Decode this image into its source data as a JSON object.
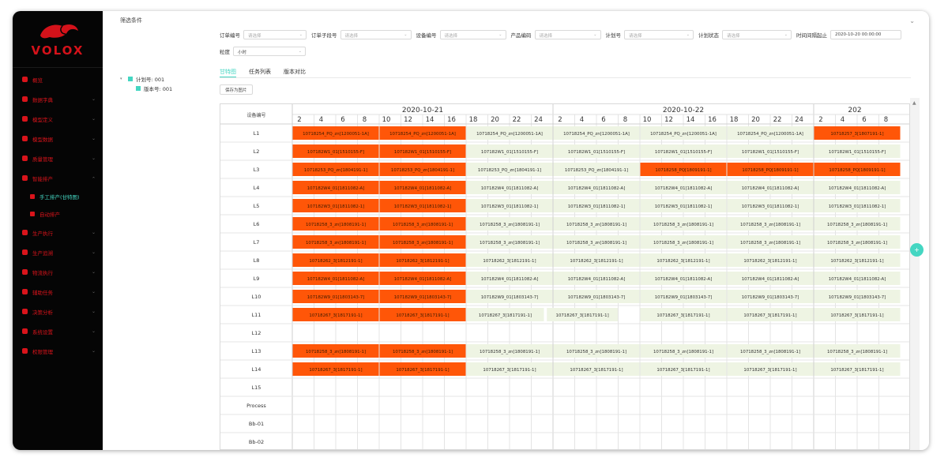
{
  "brand": {
    "name": "VOLOX",
    "color": "#d4121a"
  },
  "menu": [
    {
      "label": "概览",
      "expandable": false
    },
    {
      "label": "数据字典",
      "expandable": true
    },
    {
      "label": "模型定义",
      "expandable": true
    },
    {
      "label": "模型数据",
      "expandable": true
    },
    {
      "label": "质量管理",
      "expandable": true
    },
    {
      "label": "智能排产",
      "expandable": true,
      "open": true
    },
    {
      "label": "手工排产(甘特图)",
      "sub": true,
      "active": true
    },
    {
      "label": "自动排产",
      "sub": true
    },
    {
      "label": "生产执行",
      "expandable": true
    },
    {
      "label": "生产追溯",
      "expandable": true
    },
    {
      "label": "物流执行",
      "expandable": true
    },
    {
      "label": "辅助任务",
      "expandable": true
    },
    {
      "label": "决策分析",
      "expandable": true
    },
    {
      "label": "系统设置",
      "expandable": true
    },
    {
      "label": "权限管理",
      "expandable": true
    }
  ],
  "filters": {
    "title": "筛选条件",
    "row1": [
      {
        "label": "订单编号",
        "placeholder": "请选择"
      },
      {
        "label": "订单子段号",
        "placeholder": "请选择"
      },
      {
        "label": "设备编号",
        "placeholder": "请选择"
      },
      {
        "label": "产品编码",
        "placeholder": "请选择"
      },
      {
        "label": "计划号",
        "placeholder": "请选择"
      },
      {
        "label": "计划状态",
        "placeholder": "请选择"
      }
    ],
    "time_label": "时间间隔起止",
    "time_value": "2020-10-20 00:00:00",
    "granularity_label": "粒度",
    "granularity_value": "小时"
  },
  "tree": [
    {
      "label": "计划号: 001",
      "level": 0
    },
    {
      "label": "版本号: 001",
      "level": 1
    }
  ],
  "tabs": [
    {
      "label": "甘特图",
      "active": true
    },
    {
      "label": "任务列表",
      "active": false
    },
    {
      "label": "版本对比",
      "active": false
    }
  ],
  "export_label": "保存为图片",
  "colors": {
    "accent": "#44d6c2",
    "task_orange": "#ff5608",
    "task_green": "#eef4e3",
    "text_red": "#d9141b"
  },
  "gantt": {
    "header_label": "设备编号",
    "days": [
      {
        "label": "2020-10-21",
        "hours": [
          "2",
          "4",
          "6",
          "8",
          "10",
          "12",
          "14",
          "16",
          "18",
          "20",
          "22",
          "24"
        ]
      },
      {
        "label": "2020-10-22",
        "hours": [
          "2",
          "4",
          "6",
          "8",
          "10",
          "12",
          "14",
          "16",
          "18",
          "20",
          "22",
          "24"
        ]
      },
      {
        "label": "202",
        "hours": [
          "2",
          "4",
          "6",
          "8"
        ]
      }
    ],
    "rows": [
      {
        "name": "L1",
        "tasks": [
          {
            "s": 0,
            "e": 4,
            "c": "o",
            "t": "10718254_PQ_zn[1200051-1A]"
          },
          {
            "s": 4,
            "e": 8,
            "c": "o",
            "t": "10718254_PQ_zn[1200051-1A]"
          },
          {
            "s": 8,
            "e": 12,
            "c": "g",
            "t": "10718254_PQ_zn[1200051-1A]"
          },
          {
            "s": 12,
            "e": 16,
            "c": "g",
            "t": "10718254_PQ_zn[1200051-1A]"
          },
          {
            "s": 16,
            "e": 20,
            "c": "g",
            "t": "10718254_PQ_zn[1200051-1A]"
          },
          {
            "s": 20,
            "e": 24,
            "c": "g",
            "t": "10718254_PQ_zn[1200051-1A]"
          },
          {
            "s": 24,
            "e": 28,
            "c": "o",
            "t": "10718257_3[1807191-1]"
          }
        ]
      },
      {
        "name": "L2",
        "tasks": [
          {
            "s": 0,
            "e": 4,
            "c": "o",
            "t": "107182W1_01[1510155-F]"
          },
          {
            "s": 4,
            "e": 8,
            "c": "o",
            "t": "107182W1_01[1510155-F]"
          },
          {
            "s": 8,
            "e": 12,
            "c": "g",
            "t": "107182W1_01[1510155-F]"
          },
          {
            "s": 12,
            "e": 16,
            "c": "g",
            "t": "107182W1_01[1510155-F]"
          },
          {
            "s": 16,
            "e": 20,
            "c": "g",
            "t": "107182W1_01[1510155-F]"
          },
          {
            "s": 20,
            "e": 24,
            "c": "g",
            "t": "107182W1_01[1510155-F]"
          },
          {
            "s": 24,
            "e": 28,
            "c": "g",
            "t": "107182W1_01[1510155-F]"
          }
        ]
      },
      {
        "name": "L3",
        "tasks": [
          {
            "s": 0,
            "e": 4,
            "c": "o",
            "t": "10718253_PQ_zn[1804191-1]"
          },
          {
            "s": 4,
            "e": 8,
            "c": "o",
            "t": "10718253_PQ_zn[1804191-1]"
          },
          {
            "s": 8,
            "e": 12,
            "c": "g",
            "t": "10718253_PQ_zn[1804191-1]"
          },
          {
            "s": 12,
            "e": 16,
            "c": "g",
            "t": "10718253_PQ_zn[1804191-1]"
          },
          {
            "s": 16,
            "e": 20,
            "c": "o",
            "t": "10718258_PQ[1809191-1]"
          },
          {
            "s": 20,
            "e": 24,
            "c": "o",
            "t": "10718258_PQ[1809191-1]"
          },
          {
            "s": 24,
            "e": 28,
            "c": "o",
            "t": "10718258_PQ[1809191-1]"
          }
        ]
      },
      {
        "name": "L4",
        "tasks": [
          {
            "s": 0,
            "e": 4,
            "c": "o",
            "t": "107182W4_01[1811082-A]"
          },
          {
            "s": 4,
            "e": 8,
            "c": "o",
            "t": "107182W4_01[1811082-A]"
          },
          {
            "s": 8,
            "e": 12,
            "c": "g",
            "t": "107182W4_01[1811082-A]"
          },
          {
            "s": 12,
            "e": 16,
            "c": "g",
            "t": "107182W4_01[1811082-A]"
          },
          {
            "s": 16,
            "e": 20,
            "c": "g",
            "t": "107182W4_01[1811082-A]"
          },
          {
            "s": 20,
            "e": 24,
            "c": "g",
            "t": "107182W4_01[1811082-A]"
          },
          {
            "s": 24,
            "e": 28,
            "c": "g",
            "t": "107182W4_01[1811082-A]"
          }
        ]
      },
      {
        "name": "L5",
        "tasks": [
          {
            "s": 0,
            "e": 4,
            "c": "o",
            "t": "107182W3_01[1811082-1]"
          },
          {
            "s": 4,
            "e": 8,
            "c": "o",
            "t": "107182W3_01[1811082-1]"
          },
          {
            "s": 8,
            "e": 12,
            "c": "g",
            "t": "107182W3_01[1811082-1]"
          },
          {
            "s": 12,
            "e": 16,
            "c": "g",
            "t": "107182W3_01[1811082-1]"
          },
          {
            "s": 16,
            "e": 20,
            "c": "g",
            "t": "107182W3_01[1811082-1]"
          },
          {
            "s": 20,
            "e": 24,
            "c": "g",
            "t": "107182W3_01[1811082-1]"
          },
          {
            "s": 24,
            "e": 28,
            "c": "g",
            "t": "107182W3_01[1811082-1]"
          }
        ]
      },
      {
        "name": "L6",
        "tasks": [
          {
            "s": 0,
            "e": 4,
            "c": "o",
            "t": "10718258_3_zn[1808191-1]"
          },
          {
            "s": 4,
            "e": 8,
            "c": "o",
            "t": "10718258_3_zn[1808191-1]"
          },
          {
            "s": 8,
            "e": 12,
            "c": "g",
            "t": "10718258_3_zn[1808191-1]"
          },
          {
            "s": 12,
            "e": 16,
            "c": "g",
            "t": "10718258_3_zn[1808191-1]"
          },
          {
            "s": 16,
            "e": 20,
            "c": "g",
            "t": "10718258_3_zn[1808191-1]"
          },
          {
            "s": 20,
            "e": 24,
            "c": "g",
            "t": "10718258_3_zn[1808191-1]"
          },
          {
            "s": 24,
            "e": 28,
            "c": "g",
            "t": "10718258_3_zn[1808191-1]"
          }
        ]
      },
      {
        "name": "L7",
        "tasks": [
          {
            "s": 0,
            "e": 4,
            "c": "o",
            "t": "10718258_3_zn[1808191-1]"
          },
          {
            "s": 4,
            "e": 8,
            "c": "o",
            "t": "10718258_3_zn[1808191-1]"
          },
          {
            "s": 8,
            "e": 12,
            "c": "g",
            "t": "10718258_3_zn[1808191-1]"
          },
          {
            "s": 12,
            "e": 16,
            "c": "g",
            "t": "10718258_3_zn[1808191-1]"
          },
          {
            "s": 16,
            "e": 20,
            "c": "g",
            "t": "10718258_3_zn[1808191-1]"
          },
          {
            "s": 20,
            "e": 24,
            "c": "g",
            "t": "10718258_3_zn[1808191-1]"
          },
          {
            "s": 24,
            "e": 28,
            "c": "g",
            "t": "10718258_3_zn[1808191-1]"
          }
        ]
      },
      {
        "name": "L8",
        "tasks": [
          {
            "s": 0,
            "e": 4,
            "c": "o",
            "t": "10718262_3[1812191-1]"
          },
          {
            "s": 4,
            "e": 8,
            "c": "o",
            "t": "10718262_3[1812191-1]"
          },
          {
            "s": 8,
            "e": 12,
            "c": "g",
            "t": "10718262_3[1812191-1]"
          },
          {
            "s": 12,
            "e": 16,
            "c": "g",
            "t": "10718262_3[1812191-1]"
          },
          {
            "s": 16,
            "e": 20,
            "c": "g",
            "t": "10718262_3[1812191-1]"
          },
          {
            "s": 20,
            "e": 24,
            "c": "g",
            "t": "10718262_3[1812191-1]"
          },
          {
            "s": 24,
            "e": 28,
            "c": "g",
            "t": "10718262_3[1812191-1]"
          }
        ]
      },
      {
        "name": "L9",
        "tasks": [
          {
            "s": 0,
            "e": 4,
            "c": "o",
            "t": "107182W4_01[1811082-A]"
          },
          {
            "s": 4,
            "e": 8,
            "c": "o",
            "t": "107182W4_01[1811082-A]"
          },
          {
            "s": 8,
            "e": 12,
            "c": "g",
            "t": "107182W4_01[1811082-A]"
          },
          {
            "s": 12,
            "e": 16,
            "c": "g",
            "t": "107182W4_01[1811082-A]"
          },
          {
            "s": 16,
            "e": 20,
            "c": "g",
            "t": "107182W4_01[1811082-A]"
          },
          {
            "s": 20,
            "e": 24,
            "c": "g",
            "t": "107182W4_01[1811082-A]"
          },
          {
            "s": 24,
            "e": 28,
            "c": "g",
            "t": "107182W4_01[1811082-A]"
          }
        ]
      },
      {
        "name": "L10",
        "tasks": [
          {
            "s": 0,
            "e": 4,
            "c": "o",
            "t": "107182W9_01[1803143-7]"
          },
          {
            "s": 4,
            "e": 8,
            "c": "o",
            "t": "107182W9_01[1803143-7]"
          },
          {
            "s": 8,
            "e": 12,
            "c": "g",
            "t": "107182W9_01[1803143-7]"
          },
          {
            "s": 12,
            "e": 16,
            "c": "g",
            "t": "107182W9_01[1803143-7]"
          },
          {
            "s": 16,
            "e": 20,
            "c": "g",
            "t": "107182W9_01[1803143-7]"
          },
          {
            "s": 20,
            "e": 24,
            "c": "g",
            "t": "107182W9_01[1803143-7]"
          },
          {
            "s": 24,
            "e": 28,
            "c": "g",
            "t": "107182W9_01[1803143-7]"
          }
        ]
      },
      {
        "name": "L11",
        "tasks": [
          {
            "s": 0,
            "e": 4,
            "c": "o",
            "t": "10718267_3[1817191-1]"
          },
          {
            "s": 4,
            "e": 8,
            "c": "o",
            "t": "10718267_3[1817191-1]"
          },
          {
            "s": 8,
            "e": 11.6,
            "c": "g",
            "t": "10718267_3[1817191-1]"
          },
          {
            "s": 11.7,
            "e": 15,
            "c": "g",
            "t": "10718267_3[1817191-1]"
          },
          {
            "s": 16,
            "e": 20,
            "c": "g",
            "t": "10718267_3[1817191-1]"
          },
          {
            "s": 20,
            "e": 24,
            "c": "g",
            "t": "10718267_3[1817191-1]"
          },
          {
            "s": 24,
            "e": 28,
            "c": "g",
            "t": "10718267_3[1817191-1]"
          }
        ]
      },
      {
        "name": "L12",
        "tasks": []
      },
      {
        "name": "L13",
        "tasks": [
          {
            "s": 0,
            "e": 4,
            "c": "o",
            "t": "10718258_3_zn[1808191-1]"
          },
          {
            "s": 4,
            "e": 8,
            "c": "o",
            "t": "10718258_3_zn[1808191-1]"
          },
          {
            "s": 8,
            "e": 12,
            "c": "g",
            "t": "10718258_3_zn[1808191-1]"
          },
          {
            "s": 12,
            "e": 16,
            "c": "g",
            "t": "10718258_3_zn[1808191-1]"
          },
          {
            "s": 16,
            "e": 20,
            "c": "g",
            "t": "10718258_3_zn[1808191-1]"
          },
          {
            "s": 20,
            "e": 24,
            "c": "g",
            "t": "10718258_3_zn[1808191-1]"
          },
          {
            "s": 24,
            "e": 28,
            "c": "g",
            "t": "10718258_3_zn[1808191-1]"
          }
        ]
      },
      {
        "name": "L14",
        "tasks": [
          {
            "s": 0,
            "e": 4,
            "c": "o",
            "t": "10718267_3[1817191-1]"
          },
          {
            "s": 4,
            "e": 8,
            "c": "o",
            "t": "10718267_3[1817191-1]"
          },
          {
            "s": 8,
            "e": 12,
            "c": "g",
            "t": "10718267_3[1817191-1]"
          },
          {
            "s": 12,
            "e": 16,
            "c": "g",
            "t": "10718267_3[1817191-1]"
          },
          {
            "s": 16,
            "e": 20,
            "c": "g",
            "t": "10718267_3[1817191-1]"
          },
          {
            "s": 20,
            "e": 24,
            "c": "g",
            "t": "10718267_3[1817191-1]"
          },
          {
            "s": 24,
            "e": 28,
            "c": "g",
            "t": "10718267_3[1817191-1]"
          }
        ]
      },
      {
        "name": "L15",
        "tasks": []
      },
      {
        "name": "Process",
        "tasks": []
      },
      {
        "name": "Bb-01",
        "tasks": []
      },
      {
        "name": "Bb-02",
        "tasks": []
      }
    ]
  }
}
